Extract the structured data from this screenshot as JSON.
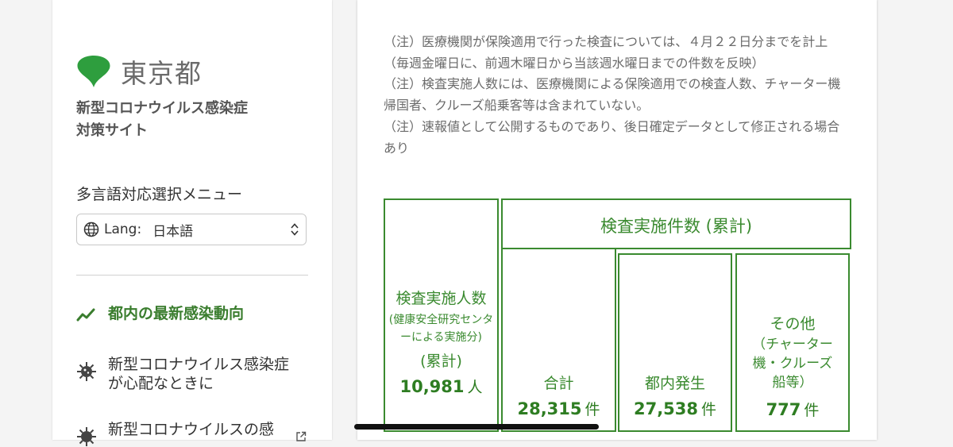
{
  "sidebar": {
    "logo_text": "東京都",
    "site_title_line1": "新型コロナウイルス感染症",
    "site_title_line2": "対策サイト",
    "lang_menu_label": "多言語対応選択メニュー",
    "lang_select_prefix": "Lang:",
    "lang_select_value": "日本語",
    "nav_items": [
      {
        "label": "都内の最新感染動向",
        "icon": "chart-line-icon",
        "active": true
      },
      {
        "label_line1": "新型コロナウイルス感染症",
        "label_line2": "が心配なときに",
        "icon": "virus-icon"
      },
      {
        "label": "新型コロナウイルスの感",
        "icon": "virus-icon"
      }
    ]
  },
  "main": {
    "notes": [
      "（注）医療機関が保険適用で行った検査については、４月２２日分までを計上",
      "（毎週金曜日に、前週木曜日から当該週水曜日までの件数を反映）",
      "（注）検査実施人数には、医療機関による保険適用での検査人数、チャーター機帰国者、クルーズ船乗客等は含まれていない。",
      "（注）速報値として公開するものであり、後日確定データとして修正される場合あり"
    ],
    "people": {
      "title": "検査実施人数",
      "sub": "(健康安全研究センターによる実施分)",
      "cumulative": "(累計)",
      "value": "10,981",
      "unit": "人"
    },
    "tests_header": "検査実施件数 (累計)",
    "total": {
      "label": "合計",
      "value": "28,315",
      "unit": "件"
    },
    "in_tokyo": {
      "label": "都内発生",
      "value": "27,538",
      "unit": "件"
    },
    "other": {
      "label": "その他",
      "sub": "（チャーター機・クルーズ船等）",
      "value": "777",
      "unit": "件"
    }
  },
  "colors": {
    "accent": "#3a8a2f",
    "logo": "#2e9e3e"
  }
}
